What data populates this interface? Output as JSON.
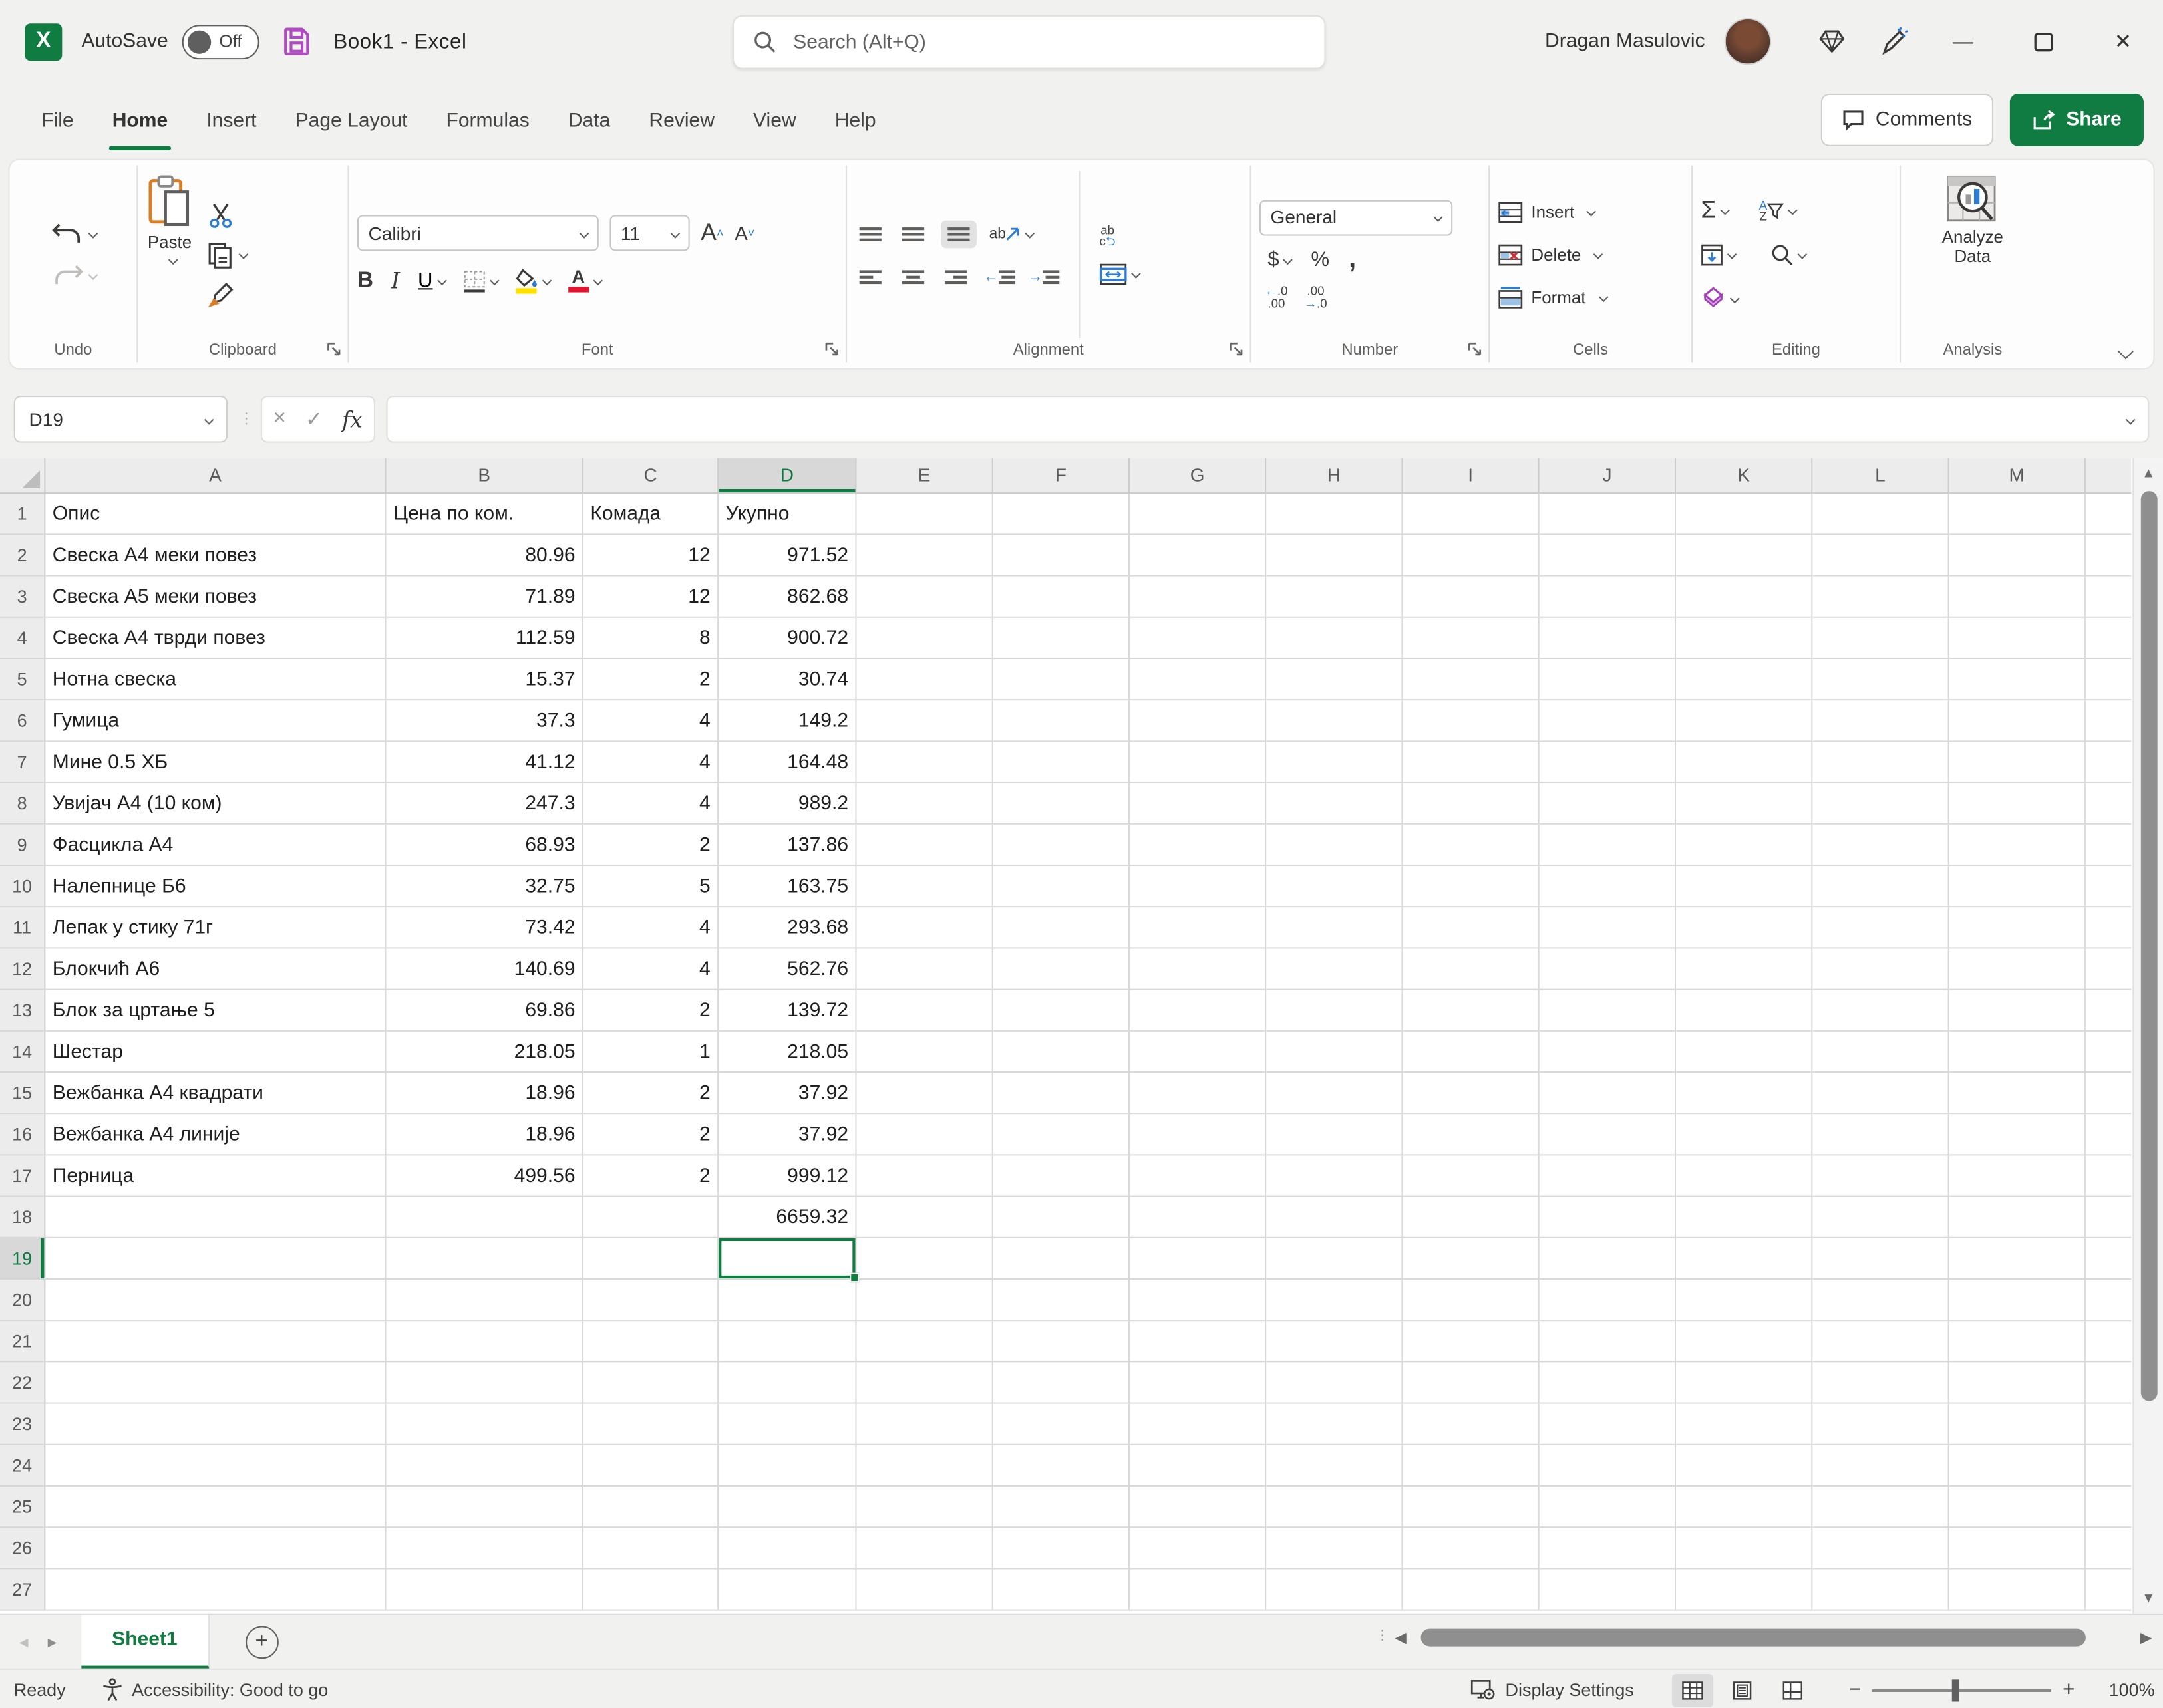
{
  "window": {
    "autosave_label": "AutoSave",
    "autosave_state": "Off",
    "doc_title": "Book1  -  Excel",
    "search_placeholder": "Search (Alt+Q)",
    "user_name": "Dragan Masulovic"
  },
  "ribbon_tabs": {
    "items": [
      "File",
      "Home",
      "Insert",
      "Page Layout",
      "Formulas",
      "Data",
      "Review",
      "View",
      "Help"
    ],
    "active": "Home",
    "comments_label": "Comments",
    "share_label": "Share"
  },
  "ribbon": {
    "undo": {
      "label": "Undo"
    },
    "clipboard": {
      "label": "Clipboard",
      "paste_label": "Paste"
    },
    "font": {
      "label": "Font",
      "font_name": "Calibri",
      "font_size": "11"
    },
    "alignment": {
      "label": "Alignment",
      "wrap_hint": "ab",
      "orient_hint": "ab"
    },
    "number": {
      "label": "Number",
      "format": "General",
      "currency": "$",
      "percent": "%",
      "comma": ",",
      "inc_dec": "←.0 .00",
      "dec_dec": ".00 →.0"
    },
    "cells": {
      "label": "Cells",
      "insert_label": "Insert",
      "delete_label": "Delete",
      "format_label": "Format"
    },
    "editing": {
      "label": "Editing",
      "autosum": "Σ",
      "sort_a": "A",
      "sort_z": "Z"
    },
    "analysis": {
      "label": "Analysis",
      "analyze_line1": "Analyze",
      "analyze_line2": "Data"
    }
  },
  "formula_bar": {
    "name_box": "D19",
    "fx_label": "fx",
    "formula_value": ""
  },
  "grid": {
    "columns": [
      "A",
      "B",
      "C",
      "D",
      "E",
      "F",
      "G",
      "H",
      "I",
      "J",
      "K",
      "L",
      "M"
    ],
    "selected_column": "D",
    "selected_row": 19,
    "row_count": 27,
    "rows": [
      {
        "r": 1,
        "A": "Опис",
        "B": "Цена по ком.",
        "C": "Комада",
        "D": "Укупно"
      },
      {
        "r": 2,
        "A": "Свеска А4 меки повез",
        "B": "80.96",
        "C": "12",
        "D": "971.52"
      },
      {
        "r": 3,
        "A": "Свеска А5 меки повез",
        "B": "71.89",
        "C": "12",
        "D": "862.68"
      },
      {
        "r": 4,
        "A": "Свеска А4 тврди повез",
        "B": "112.59",
        "C": "8",
        "D": "900.72"
      },
      {
        "r": 5,
        "A": "Нотна свеска",
        "B": "15.37",
        "C": "2",
        "D": "30.74"
      },
      {
        "r": 6,
        "A": "Гумица",
        "B": "37.3",
        "C": "4",
        "D": "149.2"
      },
      {
        "r": 7,
        "A": "Мине 0.5 ХБ",
        "B": "41.12",
        "C": "4",
        "D": "164.48"
      },
      {
        "r": 8,
        "A": "Увијач А4 (10 ком)",
        "B": "247.3",
        "C": "4",
        "D": "989.2"
      },
      {
        "r": 9,
        "A": "Фасцикла А4",
        "B": "68.93",
        "C": "2",
        "D": "137.86"
      },
      {
        "r": 10,
        "A": "Налепнице Б6",
        "B": "32.75",
        "C": "5",
        "D": "163.75"
      },
      {
        "r": 11,
        "A": "Лепак у стику 71г",
        "B": "73.42",
        "C": "4",
        "D": "293.68"
      },
      {
        "r": 12,
        "A": "Блокчић А6",
        "B": "140.69",
        "C": "4",
        "D": "562.76"
      },
      {
        "r": 13,
        "A": "Блок за цртање 5",
        "B": "69.86",
        "C": "2",
        "D": "139.72"
      },
      {
        "r": 14,
        "A": "Шестар",
        "B": "218.05",
        "C": "1",
        "D": "218.05"
      },
      {
        "r": 15,
        "A": "Вежбанка А4 квадрати",
        "B": "18.96",
        "C": "2",
        "D": "37.92"
      },
      {
        "r": 16,
        "A": "Вежбанка А4 линије",
        "B": "18.96",
        "C": "2",
        "D": "37.92"
      },
      {
        "r": 17,
        "A": "Перница",
        "B": "499.56",
        "C": "2",
        "D": "999.12"
      },
      {
        "r": 18,
        "D": "6659.32"
      }
    ]
  },
  "sheet_bar": {
    "sheet_name": "Sheet1"
  },
  "status_bar": {
    "ready": "Ready",
    "accessibility": "Accessibility: Good to go",
    "display_settings": "Display Settings",
    "zoom": "100%"
  },
  "colors": {
    "accent_green": "#107C41",
    "save_icon_purple": "#AE4BC0",
    "fill_yellow": "#FFE100",
    "font_color_red": "#E8112D",
    "selection_border": "#107C41"
  }
}
